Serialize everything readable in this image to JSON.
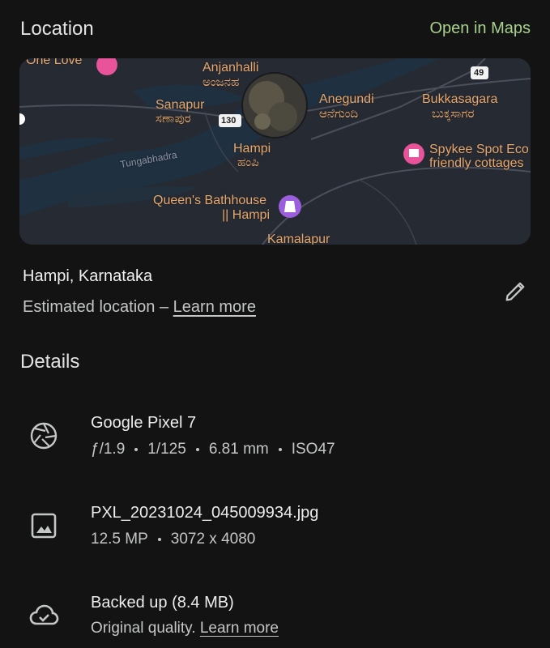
{
  "location": {
    "title": "Location",
    "open_in_maps": "Open in Maps",
    "place": "Hampi, Karnataka",
    "estimated_text": "Estimated location –",
    "learn_more": "Learn more"
  },
  "map": {
    "labels": {
      "one_love": "One Love",
      "anjanhalli": "Anjanhalli",
      "anjanhalli_kn": "ಅಂಜನಹ",
      "sanapur": "Sanapur",
      "sanapur_kn": "ಸಣಾಪುರ",
      "anegundi": "Anegundi",
      "anegundi_kn": "ಆನೆಗುಂದಿ",
      "bukkasagara": "Bukkasagara",
      "bukkasagara_kn": "ಬುಕ್ಕಸಾಗರ",
      "hampi": "Hampi",
      "hampi_kn": "ಹಂಪಿ",
      "spykee_line1": "Spykee Spot Eco",
      "spykee_line2": "friendly cottages",
      "queens_line1": "Queen's Bathhouse",
      "queens_line2": "|| Hampi",
      "kamalapur": "Kamalapur",
      "river": "Tungabhadra",
      "route_130": "130",
      "route_49": "49"
    }
  },
  "details": {
    "title": "Details",
    "camera": {
      "model": "Google Pixel 7",
      "aperture": "ƒ/1.9",
      "shutter": "1/125",
      "focal": "6.81 mm",
      "iso": "ISO47"
    },
    "file": {
      "name": "PXL_20231024_045009934.jpg",
      "megapixels": "12.5 MP",
      "resolution": "3072 x 4080"
    },
    "backup": {
      "status": "Backed up (8.4 MB)",
      "quality": "Original quality.",
      "learn_more": "Learn more"
    }
  },
  "icons": [
    "aperture-icon",
    "image-icon",
    "cloud-check-icon",
    "pencil-icon"
  ]
}
